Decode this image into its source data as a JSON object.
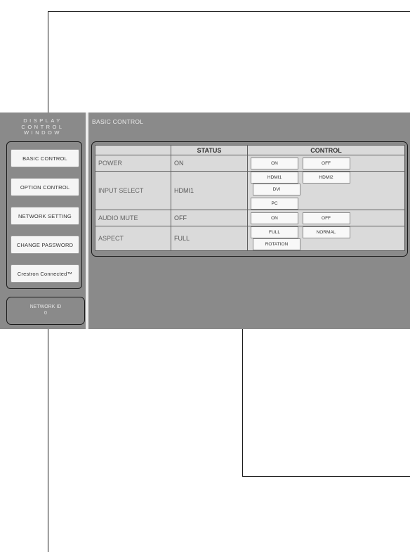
{
  "window_title": "DISPLAY\nCONTROL\nWINDOW",
  "nav": {
    "basic_control": "BASIC CONTROL",
    "option_control": "OPTION CONTROL",
    "network_setting": "NETWORK SETTING",
    "change_password": "CHANGE PASSWORD",
    "crestron": "Crestron Connected™"
  },
  "network": {
    "label": "NETWORK ID",
    "value": "0"
  },
  "main_title": "BASIC CONTROL",
  "table": {
    "headers": [
      "",
      "STATUS",
      "CONTROL"
    ],
    "rows": [
      {
        "label": "POWER",
        "status": "ON",
        "buttons": [
          "ON",
          "OFF"
        ]
      },
      {
        "label": "INPUT SELECT",
        "status": "HDMI1",
        "buttons": [
          "HDMI1",
          "HDMI2",
          "DVI",
          "PC"
        ]
      },
      {
        "label": "AUDIO MUTE",
        "status": "OFF",
        "buttons": [
          "ON",
          "OFF"
        ]
      },
      {
        "label": "ASPECT",
        "status": "FULL",
        "buttons": [
          "FULL",
          "NORMAL",
          "ROTATION"
        ]
      }
    ]
  }
}
